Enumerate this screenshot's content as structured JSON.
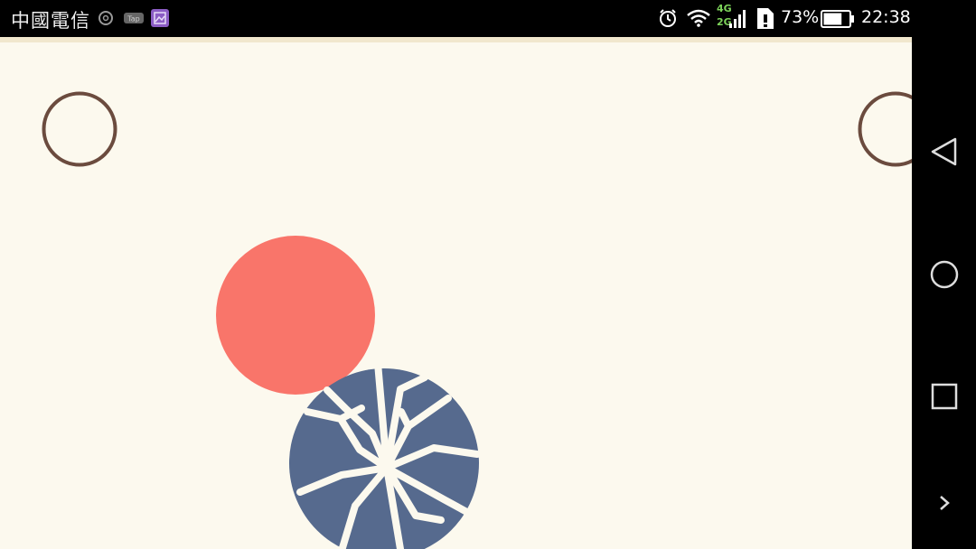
{
  "status_bar": {
    "carrier": "中國電信",
    "network_top": "4G",
    "network_bottom": "2G",
    "battery_percent": "73%",
    "battery_level": 0.73,
    "time": "22:38",
    "icons": [
      "mail-notification-icon",
      "tap-app-icon",
      "gallery-app-icon",
      "alarm-icon",
      "wifi-icon",
      "signal-icon",
      "sim-alert-icon",
      "battery-icon"
    ]
  },
  "game": {
    "background_color": "#fcf9ee",
    "target_ring_color": "#6b4b3e",
    "red_ball_color": "#f9756a",
    "broken_ball_color": "#566a8e"
  },
  "nav_bar": {
    "buttons": [
      "back-icon",
      "home-icon",
      "recents-icon",
      "expand-icon"
    ]
  }
}
